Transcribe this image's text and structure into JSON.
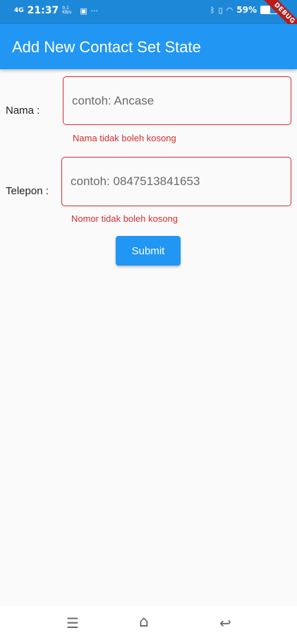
{
  "status_bar": {
    "signal": "4G",
    "time": "21:37",
    "net_speed": "0.1 KB/s",
    "more": "···",
    "battery_pct": "59%",
    "battery_level": 0.59
  },
  "debug_banner": "DEBUG",
  "app_bar": {
    "title": "Add New Contact Set State"
  },
  "form": {
    "name_label": "Nama    :",
    "name_placeholder": "contoh: Ancase",
    "name_error": "Nama tidak boleh kosong",
    "phone_label": "Telepon :",
    "phone_placeholder": "contoh: 0847513841653",
    "phone_error": "Nomor tidak boleh kosong",
    "submit_label": "Submit"
  },
  "nav_bar": {
    "menu_icon": "menu-icon",
    "home_icon": "home-icon",
    "back_icon": "back-icon"
  }
}
